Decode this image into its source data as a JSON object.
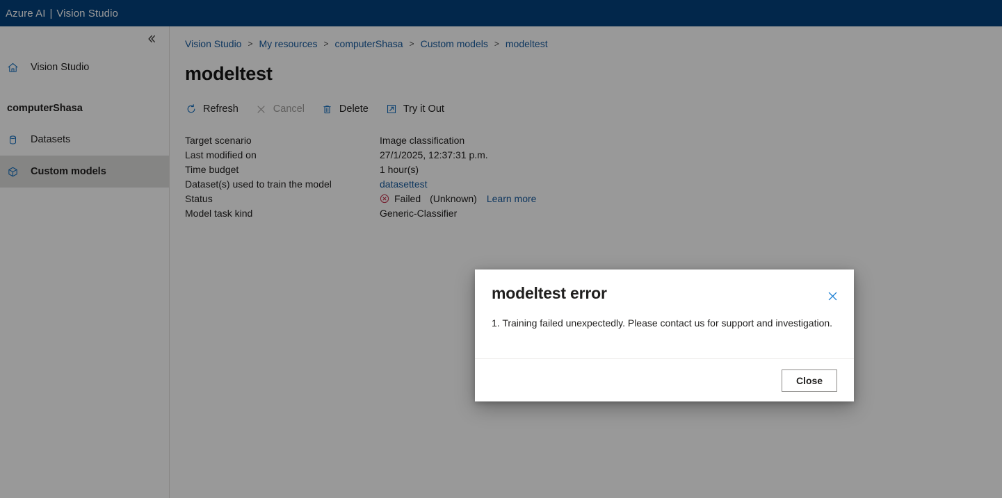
{
  "topbar": {
    "brand": "Azure AI",
    "separator": "|",
    "product": "Vision Studio"
  },
  "sidebar": {
    "collapse_icon": "chevron-double-left-icon",
    "items": [
      {
        "label": "Vision Studio",
        "icon": "home-icon",
        "type": "link",
        "active": false
      },
      {
        "label": "computerShasa",
        "icon": "",
        "type": "heading",
        "active": false
      },
      {
        "label": "Datasets",
        "icon": "database-icon",
        "type": "link",
        "active": false
      },
      {
        "label": "Custom models",
        "icon": "cube-icon",
        "type": "link",
        "active": true
      }
    ]
  },
  "breadcrumb": {
    "separator": ">",
    "items": [
      {
        "label": "Vision Studio"
      },
      {
        "label": "My resources"
      },
      {
        "label": "computerShasa"
      },
      {
        "label": "Custom models"
      },
      {
        "label": "modeltest"
      }
    ]
  },
  "page": {
    "title": "modeltest"
  },
  "toolbar": {
    "buttons": [
      {
        "label": "Refresh",
        "icon": "refresh-icon",
        "disabled": false
      },
      {
        "label": "Cancel",
        "icon": "cancel-x-icon",
        "disabled": true
      },
      {
        "label": "Delete",
        "icon": "trash-icon",
        "disabled": false
      },
      {
        "label": "Try it Out",
        "icon": "external-link-icon",
        "disabled": false
      }
    ]
  },
  "details": {
    "rows": [
      {
        "key": "Target scenario",
        "value": "Image classification",
        "kind": "text"
      },
      {
        "key": "Last modified on",
        "value": "27/1/2025, 12:37:31 p.m.",
        "kind": "text"
      },
      {
        "key": "Time budget",
        "value": "1 hour(s)",
        "kind": "text"
      },
      {
        "key": "Dataset(s) used to train the model",
        "value": "datasettest",
        "kind": "link"
      },
      {
        "key": "Status",
        "value": "Failed",
        "detail": "(Unknown)",
        "link": "Learn more",
        "kind": "status",
        "status_icon": "error-circle-x-icon",
        "status_color": "#c4314b"
      },
      {
        "key": "Model task kind",
        "value": "Generic-Classifier",
        "kind": "text"
      }
    ]
  },
  "dialog": {
    "title": "modeltest error",
    "close_icon": "close-x-icon",
    "message": "1. Training failed unexpectedly. Please contact us for support and investigation.",
    "close_button": "Close"
  },
  "colors": {
    "header_blue": "#04417d",
    "link_blue": "#175b9e",
    "icon_blue": "#0f6cbd",
    "error_red": "#c4314b",
    "active_nav": "#dededd"
  }
}
